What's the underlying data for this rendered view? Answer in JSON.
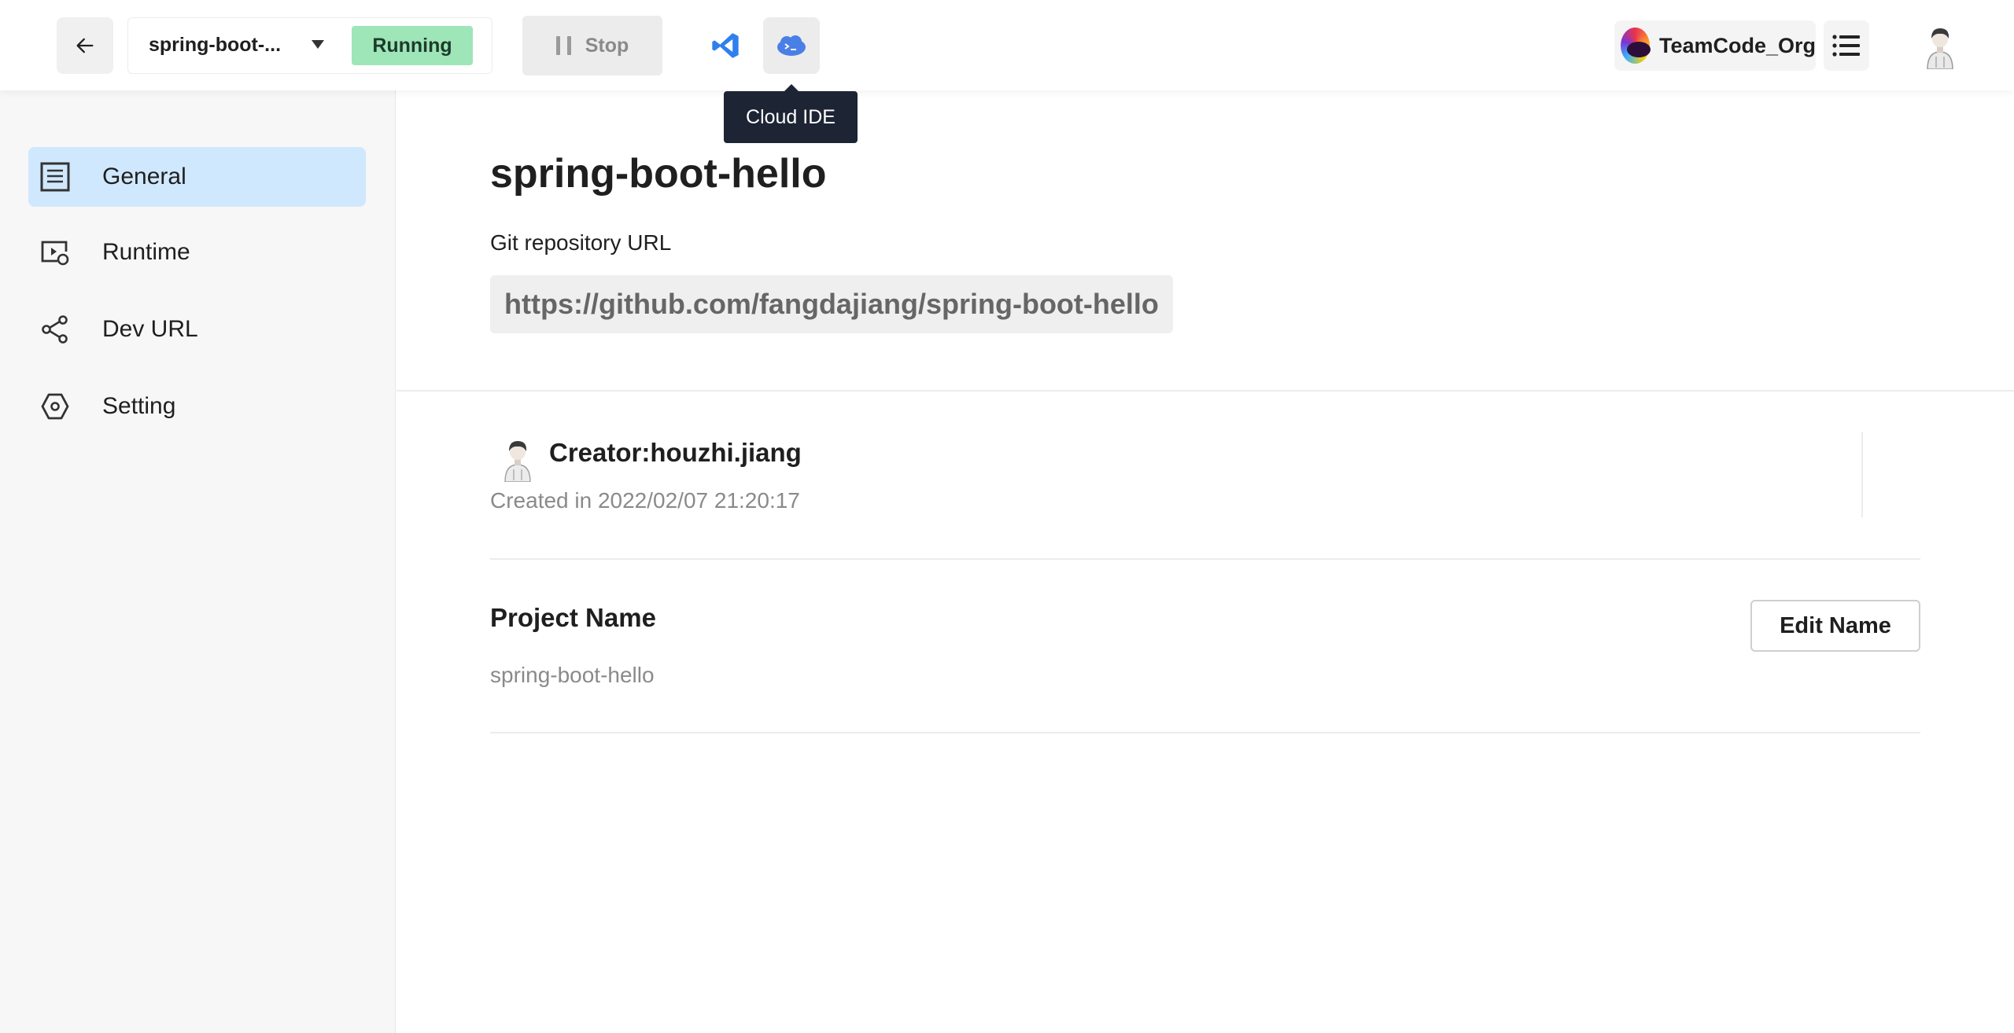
{
  "header": {
    "project_select": {
      "name": "spring-boot-...",
      "status": "Running"
    },
    "stop_label": "Stop",
    "tooltip": "Cloud IDE",
    "org_name": "TeamCode_Org"
  },
  "sidebar": {
    "items": [
      {
        "label": "General",
        "icon": "document-icon",
        "active": true
      },
      {
        "label": "Runtime",
        "icon": "runtime-icon",
        "active": false
      },
      {
        "label": "Dev URL",
        "icon": "share-icon",
        "active": false
      },
      {
        "label": "Setting",
        "icon": "hexagon-icon",
        "active": false
      }
    ]
  },
  "main": {
    "title": "spring-boot-hello",
    "repo_label": "Git repository URL",
    "repo_url": "https://github.com/fangdajiang/spring-boot-hello",
    "creator": "Creator:houzhi.jiang",
    "created_at": "Created in 2022/02/07 21:20:17",
    "project_name_label": "Project Name",
    "project_name_value": "spring-boot-hello",
    "edit_button": "Edit Name"
  },
  "colors": {
    "accent_active": "#d0e8fd",
    "running_badge": "#9ee5b8",
    "tooltip_bg": "#1d2433"
  }
}
